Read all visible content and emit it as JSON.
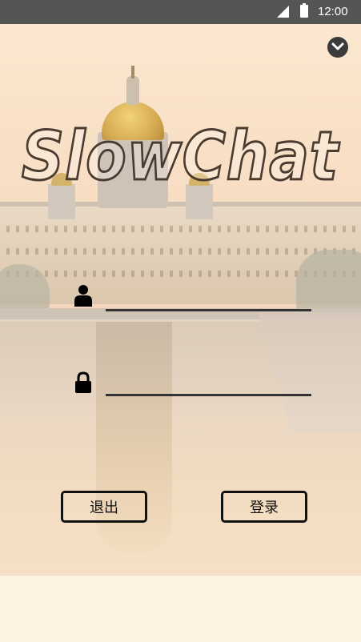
{
  "status_bar": {
    "time": "12:00",
    "signal_icon": "cell-signal-icon",
    "battery_icon": "battery-icon"
  },
  "header": {
    "menu_icon": "chevron-down-circle-icon",
    "app_logo_text": "SlowChat"
  },
  "login_form": {
    "username": {
      "icon": "user-icon",
      "value": "",
      "placeholder": ""
    },
    "password": {
      "icon": "lock-icon",
      "value": "",
      "placeholder": ""
    }
  },
  "buttons": {
    "exit_label": "退出",
    "login_label": "登录"
  },
  "colors": {
    "status_bar": "#555555",
    "text_dark": "#111111",
    "logo_outline": "#4a3c30",
    "background_warm": "#fdf1e2"
  }
}
